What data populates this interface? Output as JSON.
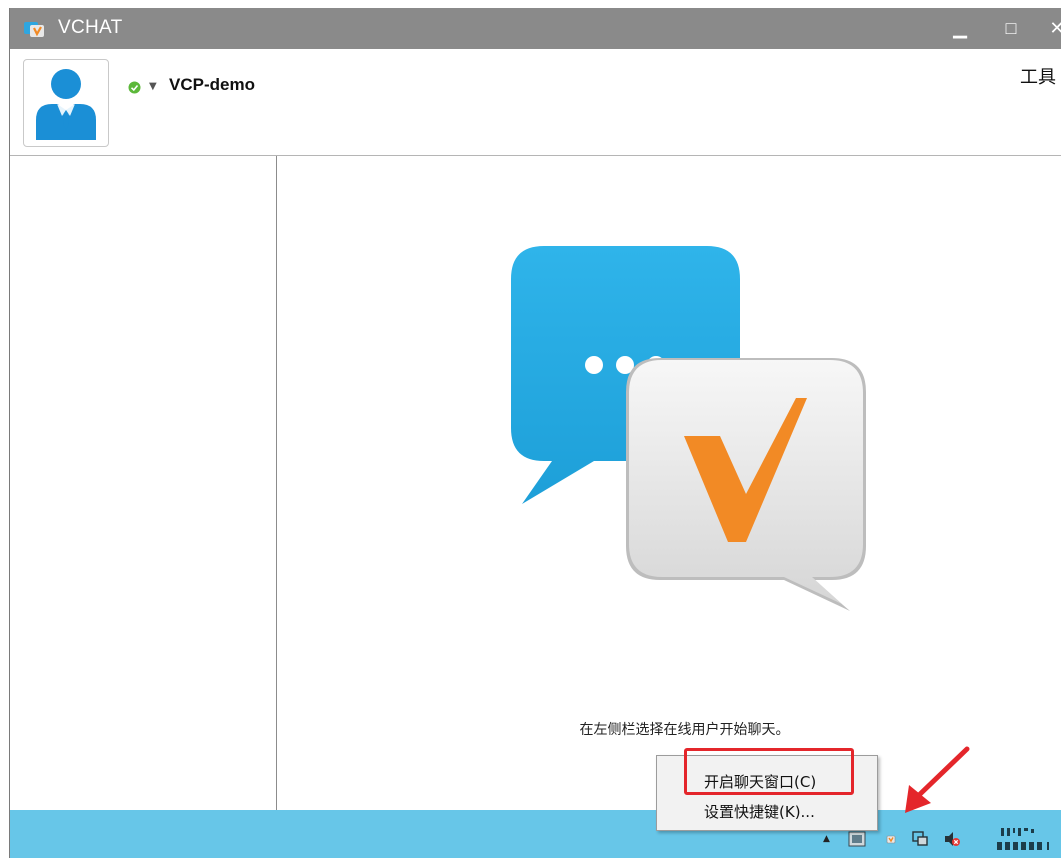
{
  "window": {
    "title": "VCHAT",
    "minimize_glyph": "▁",
    "maximize_glyph": "□",
    "close_glyph": "✕"
  },
  "header": {
    "username": "VCP-demo",
    "status": "online",
    "tools_label": "工具"
  },
  "main": {
    "hint": "在左侧栏选择在线用户开始聊天。"
  },
  "context_menu": {
    "items": [
      {
        "label": "开启聊天窗口(C)"
      },
      {
        "label": "设置快捷键(K)..."
      }
    ]
  },
  "taskbar": {
    "tray_icons": [
      "tray-app-icon",
      "vchat-tray-icon",
      "network-icon",
      "volume-muted-icon"
    ]
  },
  "colors": {
    "titlebar": "#8a8a8a",
    "accent_blue": "#29abe2",
    "accent_orange": "#f28a25",
    "taskbar": "#67c6e8",
    "highlight_red": "#e4262b"
  }
}
